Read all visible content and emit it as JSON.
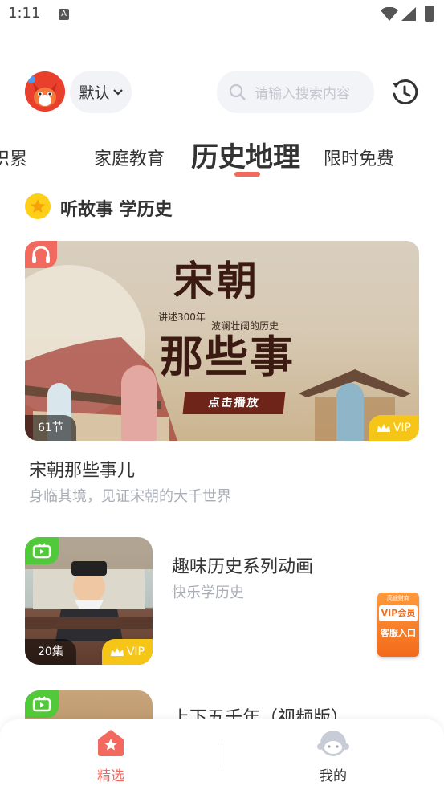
{
  "status_bar": {
    "time": "1:11",
    "indicator": "A"
  },
  "header": {
    "sort_label": "默认",
    "search_placeholder": "请输入搜索内容"
  },
  "tabs": [
    {
      "label": "积累",
      "visible_text": "识累"
    },
    {
      "label": "家庭教育"
    },
    {
      "label": "历史地理",
      "active": true
    },
    {
      "label": "限时免费"
    }
  ],
  "section": {
    "title": "听故事 学历史"
  },
  "banner_card": {
    "art_title_1": "宋朝",
    "art_title_2": "那些事",
    "art_sub_1": "讲述300年",
    "art_sub_2": "波澜壮阔的历史",
    "art_play": "点击播放",
    "count": "61节",
    "vip": "VIP",
    "title": "宋朝那些事儿",
    "desc": "身临其境，见证宋朝的大千世界"
  },
  "list_items": [
    {
      "title": "趣味历史系列动画",
      "desc": "快乐学历史",
      "count": "20集",
      "vip": "VIP"
    },
    {
      "title": "上下五千年（视频版）"
    }
  ],
  "service_float": {
    "top_text": "高途财商",
    "vip_text": "VIP会员",
    "entry_text": "客服入口"
  },
  "bottom_nav": [
    {
      "label": "精选",
      "active": true,
      "color": "#f26a5f"
    },
    {
      "label": "我的",
      "active": false,
      "color": "#333333"
    }
  ],
  "colors": {
    "accent": "#f26a5f",
    "vip": "#f5c518",
    "video": "#52c93a"
  }
}
